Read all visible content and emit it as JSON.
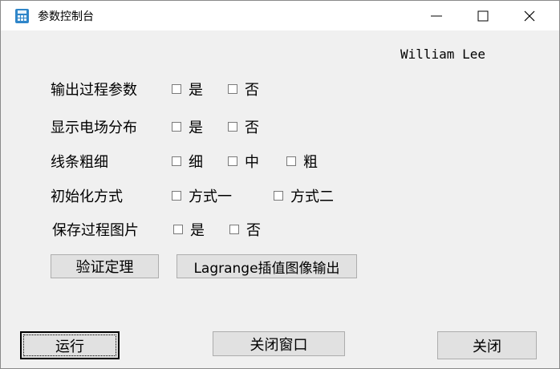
{
  "window": {
    "title": "参数控制台"
  },
  "signature": "William Lee",
  "rows": [
    {
      "label": "输出过程参数",
      "options": [
        "是",
        "否"
      ]
    },
    {
      "label": "显示电场分布",
      "options": [
        "是",
        "否"
      ]
    },
    {
      "label": "线条粗细",
      "options": [
        "细",
        "中",
        "粗"
      ]
    },
    {
      "label": "初始化方式",
      "options": [
        "方式一",
        "方式二"
      ]
    },
    {
      "label": "保存过程图片",
      "options": [
        "是",
        "否"
      ]
    }
  ],
  "buttons": {
    "verify": "验证定理",
    "lagrange": "Lagrange插值图像输出",
    "run": "运行",
    "close_window": "关闭窗口",
    "close": "关闭"
  }
}
